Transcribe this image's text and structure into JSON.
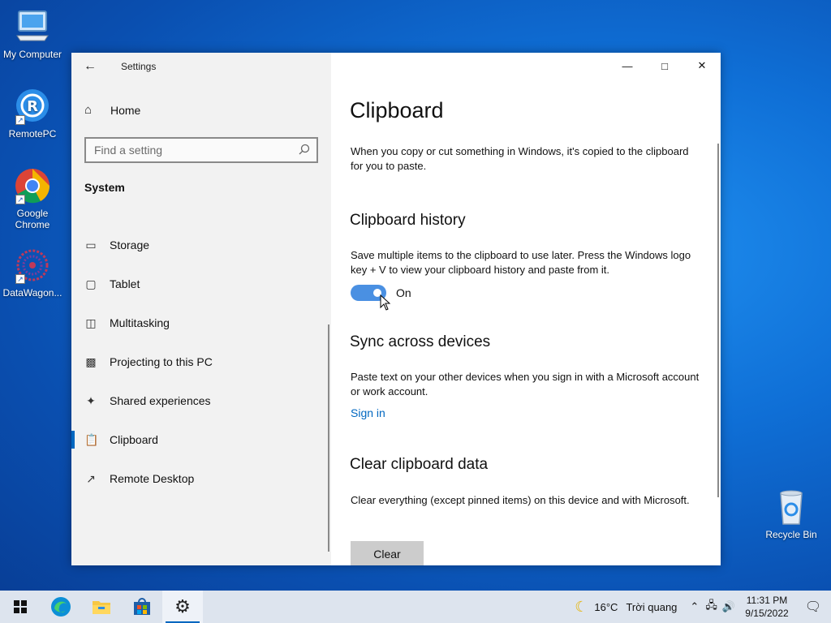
{
  "desktop": {
    "icons": [
      {
        "label": "My Computer"
      },
      {
        "label": "RemotePC"
      },
      {
        "label": "Google Chrome"
      },
      {
        "label": "DataWagon..."
      },
      {
        "label": "Recycle Bin"
      }
    ]
  },
  "window": {
    "title": "Settings",
    "nav": {
      "home": "Home",
      "search_placeholder": "Find a setting",
      "group": "System",
      "items": [
        {
          "label": "Storage",
          "icon": "storage-icon"
        },
        {
          "label": "Tablet",
          "icon": "tablet-icon"
        },
        {
          "label": "Multitasking",
          "icon": "multitasking-icon"
        },
        {
          "label": "Projecting to this PC",
          "icon": "projecting-icon"
        },
        {
          "label": "Shared experiences",
          "icon": "shared-experiences-icon"
        },
        {
          "label": "Clipboard",
          "icon": "clipboard-icon",
          "active": true
        },
        {
          "label": "Remote Desktop",
          "icon": "remote-desktop-icon"
        }
      ]
    },
    "content": {
      "title": "Clipboard",
      "intro": "When you copy or cut something in Windows, it's copied to the clipboard for you to paste.",
      "history_heading": "Clipboard history",
      "history_desc": "Save multiple items to the clipboard to use later. Press the Windows logo key + V to view your clipboard history and paste from it.",
      "history_toggle": "On",
      "sync_heading": "Sync across devices",
      "sync_desc": "Paste text on your other devices when you sign in with a Microsoft account or work account.",
      "sign_in": "Sign in",
      "clear_heading": "Clear clipboard data",
      "clear_desc": "Clear everything (except pinned items) on this device and with Microsoft.",
      "clear_button": "Clear"
    }
  },
  "taskbar": {
    "weather_temp": "16°C",
    "weather_text": "Trời quang",
    "time": "11:31 PM",
    "date": "9/15/2022"
  },
  "colors": {
    "accent": "#0067c0",
    "toggle_on": "#4a90e2",
    "nav_bg": "#f2f2f2"
  }
}
